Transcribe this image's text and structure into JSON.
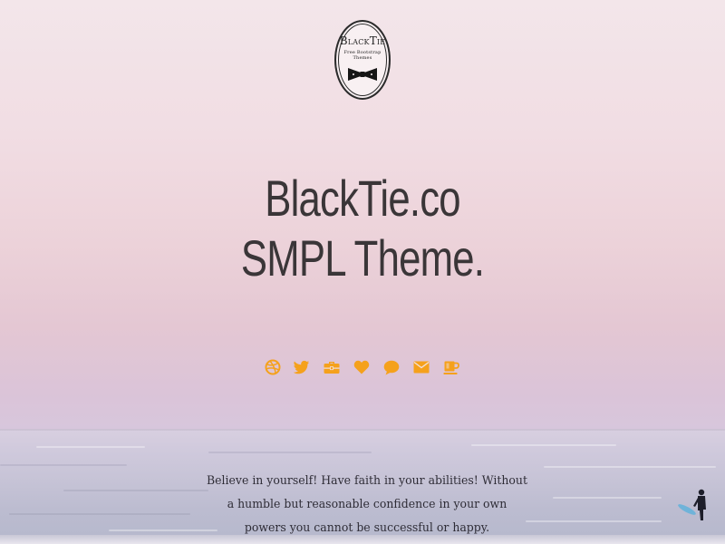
{
  "logo": {
    "title": "BlackTie",
    "subtitle": "Free Bootstrap Themes"
  },
  "headline": {
    "line1": "BlackTie.co",
    "line2": "SMPL Theme."
  },
  "icons": [
    {
      "name": "dribbble-icon"
    },
    {
      "name": "twitter-icon"
    },
    {
      "name": "briefcase-icon"
    },
    {
      "name": "heart-icon"
    },
    {
      "name": "chat-icon"
    },
    {
      "name": "mail-icon"
    },
    {
      "name": "coffee-icon"
    }
  ],
  "quote": {
    "text": "Believe in yourself! Have faith in your abilities! Without a humble but reasonable confidence in your own powers you cannot be successful or happy."
  },
  "colors": {
    "accent": "#f5a11c",
    "headline": "#3a3638",
    "sky_top": "#f3e6ea",
    "sky_bottom": "#d7c6dc",
    "sea": "#c6c3d6"
  }
}
